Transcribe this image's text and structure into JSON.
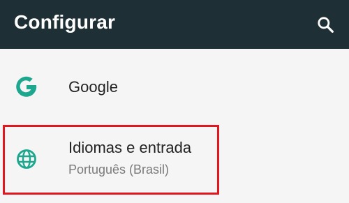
{
  "appbar": {
    "title": "Configurar",
    "search_icon": "search-icon",
    "background": "#1f2f36"
  },
  "items": [
    {
      "title": "Google",
      "icon": "google-g-icon",
      "icon_color": "#1ea78f"
    },
    {
      "title": "Idiomas e entrada",
      "subtitle": "Português (Brasil)",
      "icon": "globe-icon",
      "icon_color": "#1ea78f",
      "highlighted": true
    }
  ],
  "colors": {
    "accent": "#1ea78f",
    "highlight_border": "#e2161e",
    "background": "#f5f5f5"
  }
}
